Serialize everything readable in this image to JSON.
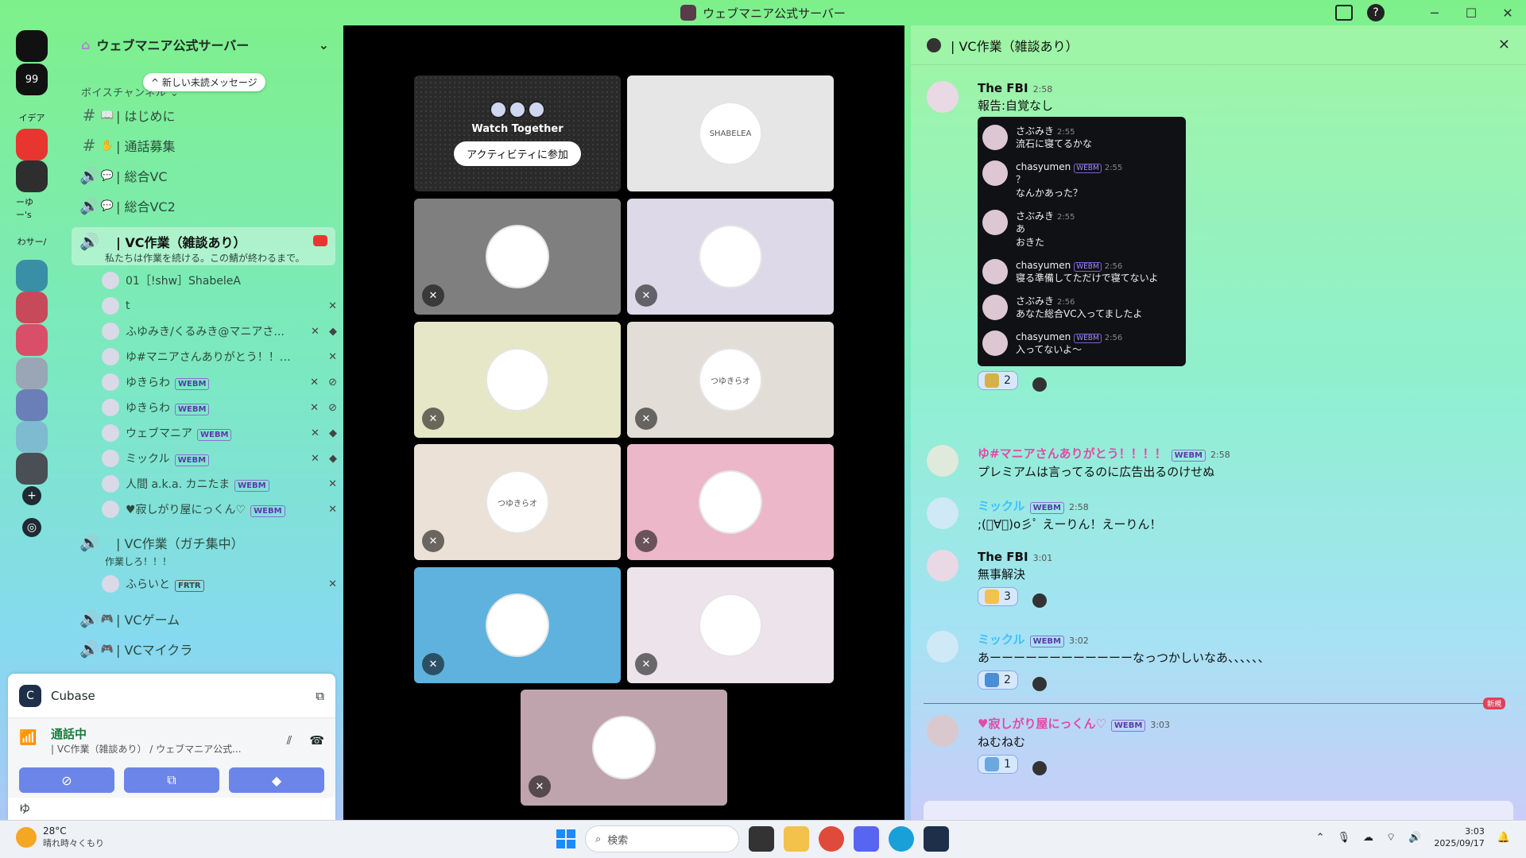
{
  "window": {
    "title": "ウェブマニア公式サーバー"
  },
  "server": {
    "name": "ウェブマニア公式サーバー",
    "new_messages": "新しい未読メッセージ",
    "category": "ボイスチャンネル"
  },
  "rail": [
    {
      "label": "",
      "color": "#111111"
    },
    {
      "label": "99",
      "color": "#111111"
    },
    {
      "label": "イデア",
      "color": "transparent"
    },
    {
      "label": "",
      "color": "#e8352f"
    },
    {
      "label": "",
      "color": "#2e2e2e"
    },
    {
      "label": "ーゆー's",
      "color": "transparent"
    },
    {
      "label": "わサー/",
      "color": "transparent"
    },
    {
      "label": "",
      "color": "#3a8fa6"
    },
    {
      "label": "",
      "color": "#c74a5a"
    },
    {
      "label": "",
      "color": "#d94f6a"
    },
    {
      "label": "",
      "color": "#9aa6b6"
    },
    {
      "label": "",
      "color": "#6a7fb8"
    },
    {
      "label": "",
      "color": "#7fbbd0"
    },
    {
      "label": "",
      "color": "#4a4f55"
    },
    {
      "label": "+",
      "color": "#1f2a33"
    },
    {
      "label": "◎",
      "color": "#1f2a33"
    }
  ],
  "channels": [
    {
      "kind": "#",
      "emoji": "📖",
      "name": "| はじめに"
    },
    {
      "kind": "#",
      "emoji": "✋",
      "name": "| 通話募集"
    },
    {
      "kind": "🔊",
      "emoji": "💬",
      "name": "| 総合VC"
    },
    {
      "kind": "🔊",
      "emoji": "💬",
      "name": "| 総合VC2"
    }
  ],
  "active_channel": {
    "name": "| VC作業（雑談あり）",
    "topic": "私たちは作業を続ける。この鯖が終わるまで。"
  },
  "voice_users": [
    {
      "name": "01［!shw］ShabeleA",
      "tag": "",
      "icons": ""
    },
    {
      "name": "t",
      "tag": "",
      "icons": "✕"
    },
    {
      "name": "ふゆみき/くるみき@マニアさ...",
      "tag": "",
      "icons": "✕ ◆"
    },
    {
      "name": "ゆ#マニアさんありがとう！！！！",
      "tag": "",
      "icons": "✕"
    },
    {
      "name": "ゆきらわ",
      "tag": "WEBM",
      "icons": "✕ ⊘"
    },
    {
      "name": "ゆきらわ",
      "tag": "WEBM",
      "icons": "✕ ⊘"
    },
    {
      "name": "ウェブマニア",
      "tag": "WEBM",
      "icons": "✕ ◆"
    },
    {
      "name": "ミックル",
      "tag": "WEBM",
      "icons": "✕ ◆"
    },
    {
      "name": "人間 a.k.a. カニたま",
      "tag": "WEBM",
      "icons": "✕"
    },
    {
      "name": "♥寂しがり屋にっくん♡",
      "tag": "WEBM",
      "icons": "✕"
    }
  ],
  "channel2": {
    "name": "| VC作業（ガチ集中）",
    "topic": "作業しろ！！！",
    "user": "ふらいと",
    "user_tag": "FRTR"
  },
  "channels_bottom": [
    {
      "kind": "🔊",
      "emoji": "🎮",
      "name": "| VCゲーム"
    },
    {
      "kind": "🔊",
      "emoji": "🎮",
      "name": "| VCマイクラ"
    }
  ],
  "activity": {
    "app": "Cubase",
    "status": "通話中",
    "location": "| VC作業（雑談あり） / ウェブマニア公式...",
    "user_partial": "ゆ"
  },
  "grid": {
    "watch_title": "Watch Together",
    "join_label": "アクティビティに参加",
    "tiles": [
      {
        "bg": "#e6e6e6",
        "avatar": "SHABELEA"
      },
      {
        "bg": "#7f7f7f",
        "avatar": ""
      },
      {
        "bg": "#ded9e8",
        "avatar": ""
      },
      {
        "bg": "#e6e7c7",
        "avatar": ""
      },
      {
        "bg": "#e2ded7",
        "avatar": "つゆきらオ"
      },
      {
        "bg": "#ece1d6",
        "avatar": "つゆきらオ"
      },
      {
        "bg": "#ecb7c8",
        "avatar": ""
      },
      {
        "bg": "#5fb2de",
        "avatar": ""
      },
      {
        "bg": "#ece4ea",
        "avatar": ""
      },
      {
        "bg": "#bfa3ad",
        "avatar": ""
      }
    ]
  },
  "chat": {
    "title": "| VC作業（雑談あり）",
    "messages": [
      {
        "author": "The FBI",
        "time": "2:58",
        "text": "報告:自覚なし",
        "style": ""
      },
      {
        "author": "ゆ#マニアさんありがとう！！！！",
        "tag": "WEBM",
        "time": "2:58",
        "text": "プレミアムは言ってるのに広告出るのけせぬ",
        "style": "pink"
      },
      {
        "author": "ミックル",
        "tag": "WEBM",
        "time": "2:58",
        "text": ";(ﾟ∀ﾟ)o彡ﾟ えーりん！えーりん！",
        "style": "cyan"
      },
      {
        "author": "The FBI",
        "time": "3:01",
        "text": "無事解決",
        "style": ""
      },
      {
        "author": "ミックル",
        "tag": "WEBM",
        "time": "3:02",
        "text": "あーーーーーーーーーーーーなっつかしいなあ、、、、、、",
        "style": "cyan"
      },
      {
        "author": "♥寂しがり屋にっくん♡",
        "tag": "WEBM",
        "time": "3:03",
        "text": "ねむねむ",
        "style": "pink"
      }
    ],
    "embed": [
      {
        "name": "さぶみき",
        "tag": "",
        "time": "2:55",
        "lines": [
          "流石に寝てるかな"
        ]
      },
      {
        "name": "chasyumen",
        "tag": "WEBM",
        "time": "2:55",
        "lines": [
          "？",
          "なんかあった？"
        ]
      },
      {
        "name": "さぶみき",
        "tag": "",
        "time": "2:55",
        "lines": [
          "あ",
          "おきた"
        ]
      },
      {
        "name": "chasyumen",
        "tag": "WEBM",
        "time": "2:56",
        "lines": [
          "寝る準備してただけで寝てないよ"
        ]
      },
      {
        "name": "さぶみき",
        "tag": "",
        "time": "2:56",
        "lines": [
          "あなた総合VC入ってましたよ"
        ]
      },
      {
        "name": "chasyumen",
        "tag": "WEBM",
        "time": "2:56",
        "lines": [
          "入ってないよ～"
        ]
      }
    ],
    "reactions": [
      "2",
      "3",
      "2",
      "1"
    ],
    "new_label": "新規"
  },
  "taskbar": {
    "temp": "28°C",
    "weather": "晴れ時々くもり",
    "search": "検索",
    "time": "3:03",
    "date": "2025/09/17"
  }
}
